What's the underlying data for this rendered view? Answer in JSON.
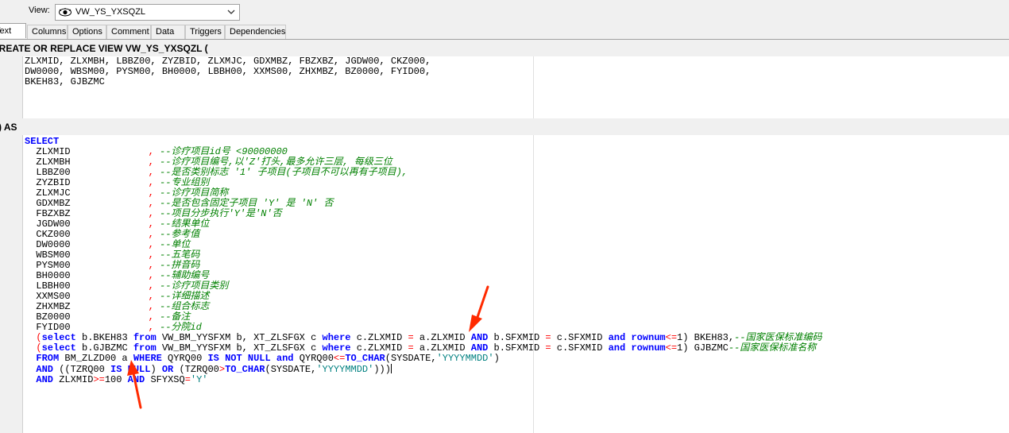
{
  "toolbar": {
    "view_label": "View:",
    "view_value": "VW_YS_YXSQZL",
    "view_icon": "eye-icon"
  },
  "tabs": [
    {
      "label": "Text",
      "active": true
    },
    {
      "label": "Columns"
    },
    {
      "label": "Options"
    },
    {
      "label": "Comment"
    },
    {
      "label": "Data"
    },
    {
      "label": "Triggers"
    },
    {
      "label": "Dependencies"
    }
  ],
  "header_section": {
    "title": "CREATE OR REPLACE VIEW VW_YS_YXSQZL ("
  },
  "columns_text": "ZLXMID, ZLXMBH, LBBZ00, ZYZBID, ZLXMJC, GDXMBZ, FBZXBZ, JGDW00, CKZ000,\nDW0000, WBSM00, PYSM00, BH0000, LBBH00, XXMS00, ZHXMBZ, BZ0000, FYID00,\nBKEH83, GJBZMC",
  "as_section": {
    "title": ") AS"
  },
  "query": {
    "select_kw": "SELECT",
    "fields": [
      {
        "name": "ZLXMID",
        "comment": "--诊疗项目id号 <90000000"
      },
      {
        "name": "ZLXMBH",
        "comment": "--诊疗项目编号,以'Z'打头,最多允许三层, 每级三位"
      },
      {
        "name": "LBBZ00",
        "comment": "--是否类别标志 '1' 子项目(子项目不可以再有子项目),"
      },
      {
        "name": "ZYZBID",
        "comment": "--专业组别"
      },
      {
        "name": "ZLXMJC",
        "comment": "--诊疗项目简称"
      },
      {
        "name": "GDXMBZ",
        "comment": "--是否包含固定子项目 'Y' 是 'N' 否"
      },
      {
        "name": "FBZXBZ",
        "comment": "--项目分步执行'Y'是'N'否"
      },
      {
        "name": "JGDW00",
        "comment": "--结果单位"
      },
      {
        "name": "CKZ000",
        "comment": "--参考值"
      },
      {
        "name": "DW0000",
        "comment": "--单位"
      },
      {
        "name": "WBSM00",
        "comment": "--五笔码"
      },
      {
        "name": "PYSM00",
        "comment": "--拼音码"
      },
      {
        "name": "BH0000",
        "comment": "--辅助编号"
      },
      {
        "name": "LBBH00",
        "comment": "--诊疗项目类别"
      },
      {
        "name": "XXMS00",
        "comment": "--详细描述"
      },
      {
        "name": "ZHXMBZ",
        "comment": "--组合标志"
      },
      {
        "name": "BZ0000",
        "comment": "--备注"
      },
      {
        "name": "FYID00",
        "comment": "--分院id"
      }
    ],
    "sub1": {
      "p1": "(",
      "kw_select": "select",
      "p2": " b.BKEH83 ",
      "kw_from": "from",
      "p3": " VW_BM_YYSFXM b, XT_ZLSFGX c ",
      "kw_where": "where",
      "p4": " c.ZLXMID ",
      "eq1": "=",
      "p5": " a.ZLXMID ",
      "kw_and": "AND",
      "p6": " b.SFXMID ",
      "eq2": "=",
      "p7": " c.SFXMID ",
      "kw_and2": "and",
      "kw_rownum": "rownum",
      "op": "<=",
      "p8": "1) BKEH83,",
      "comment": "--国家医保标准编码"
    },
    "sub2": {
      "p1": "(",
      "kw_select": "select",
      "p2": " b.GJBZMC ",
      "kw_from": "from",
      "p3": " VW_BM_YYSFXM b, XT_ZLSFGX c ",
      "kw_where": "where",
      "p4": " c.ZLXMID ",
      "eq1": "=",
      "p5": " a.ZLXMID ",
      "kw_and": "AND",
      "p6": " b.SFXMID ",
      "eq2": "=",
      "p7": " c.SFXMID ",
      "kw_and2": "and",
      "kw_rownum": "rownum",
      "op": "<=",
      "p8": "1) GJBZMC",
      "comment": "--国家医保标准名称"
    },
    "from_line": {
      "kw_from": "FROM",
      "p1": " BM_ZLZD00 a ",
      "kw_where": "WHERE",
      "p2": " QYRQ00 ",
      "kw_is": "IS NOT NULL",
      "p3": " ",
      "kw_and": "and",
      "p4": " QYRQ00",
      "op": "<=",
      "fn": "TO_CHAR",
      "p5": "(SYSDATE,",
      "str": "'YYYYMMDD'",
      "p6": ")"
    },
    "and_line1": {
      "kw_and": "AND",
      "p1": " ((TZRQ00 ",
      "kw_isnull": "IS NULL",
      "p2": ") ",
      "kw_or": "OR",
      "p3": " (TZRQ00",
      "op": ">",
      "fn": "TO_CHAR",
      "p4": "(SYSDATE,",
      "str": "'YYYYMMDD'",
      "p5": ")))"
    },
    "and_line2": {
      "kw_and": "AND",
      "p1": " ZLXMID",
      "op": ">=",
      "p2": "100 ",
      "kw_and2": "AND",
      "p3": " SFYXSQ",
      "op2": "=",
      "str": "'Y'"
    }
  },
  "colors": {
    "keyword": "#0000ff",
    "operator": "#ff0000",
    "comment": "#008000",
    "string": "#008080",
    "arrow": "#ff2a00"
  }
}
